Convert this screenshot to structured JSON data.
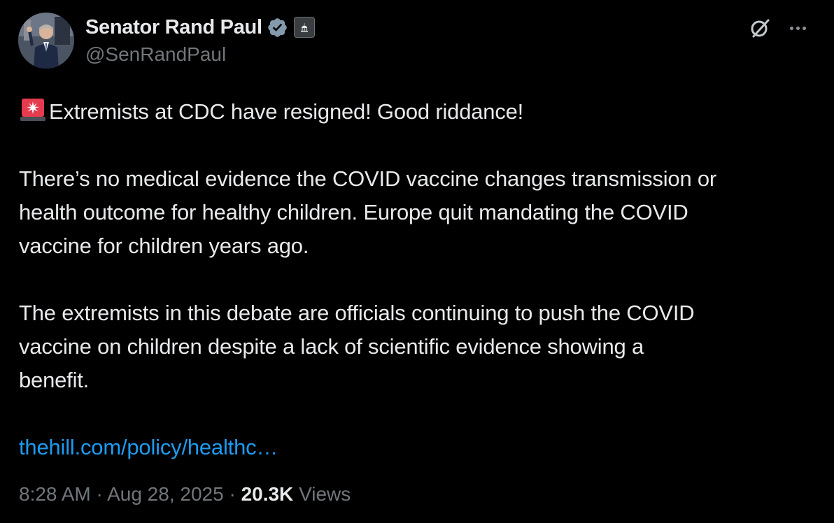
{
  "author": {
    "display_name": "Senator Rand Paul",
    "handle": "@SenRandPaul",
    "avatar_icon": "senator-portrait-avatar",
    "verified_icon": "verified-badge-icon",
    "affiliation_icon": "government-building-icon"
  },
  "header_actions": {
    "grok_icon": "grok-icon",
    "more_icon": "more-options-icon"
  },
  "tweet": {
    "line1_emoji": "🚨",
    "line1": "Extremists at CDC have resigned! Good riddance!",
    "para2_line1": "There’s no medical evidence the COVID vaccine changes transmission or",
    "para2_line2": "health outcome for healthy children. Europe quit mandating the COVID",
    "para2_line3": "vaccine for children years ago.",
    "para3_line1": "The extremists in this debate are officials continuing to push the COVID",
    "para3_line2": "vaccine on children despite a lack of scientific evidence showing a",
    "para3_line3": "benefit.",
    "link_text": "thehill.com/policy/healthc…"
  },
  "meta": {
    "time": "8:28 AM",
    "separator": "·",
    "date": "Aug 28, 2025",
    "views_count": "20.3K",
    "views_label": "Views"
  },
  "colors": {
    "background": "#000000",
    "text_primary": "#e7e9ea",
    "text_secondary": "#71767b",
    "link": "#1d9bf0",
    "verified": "#829aab"
  }
}
